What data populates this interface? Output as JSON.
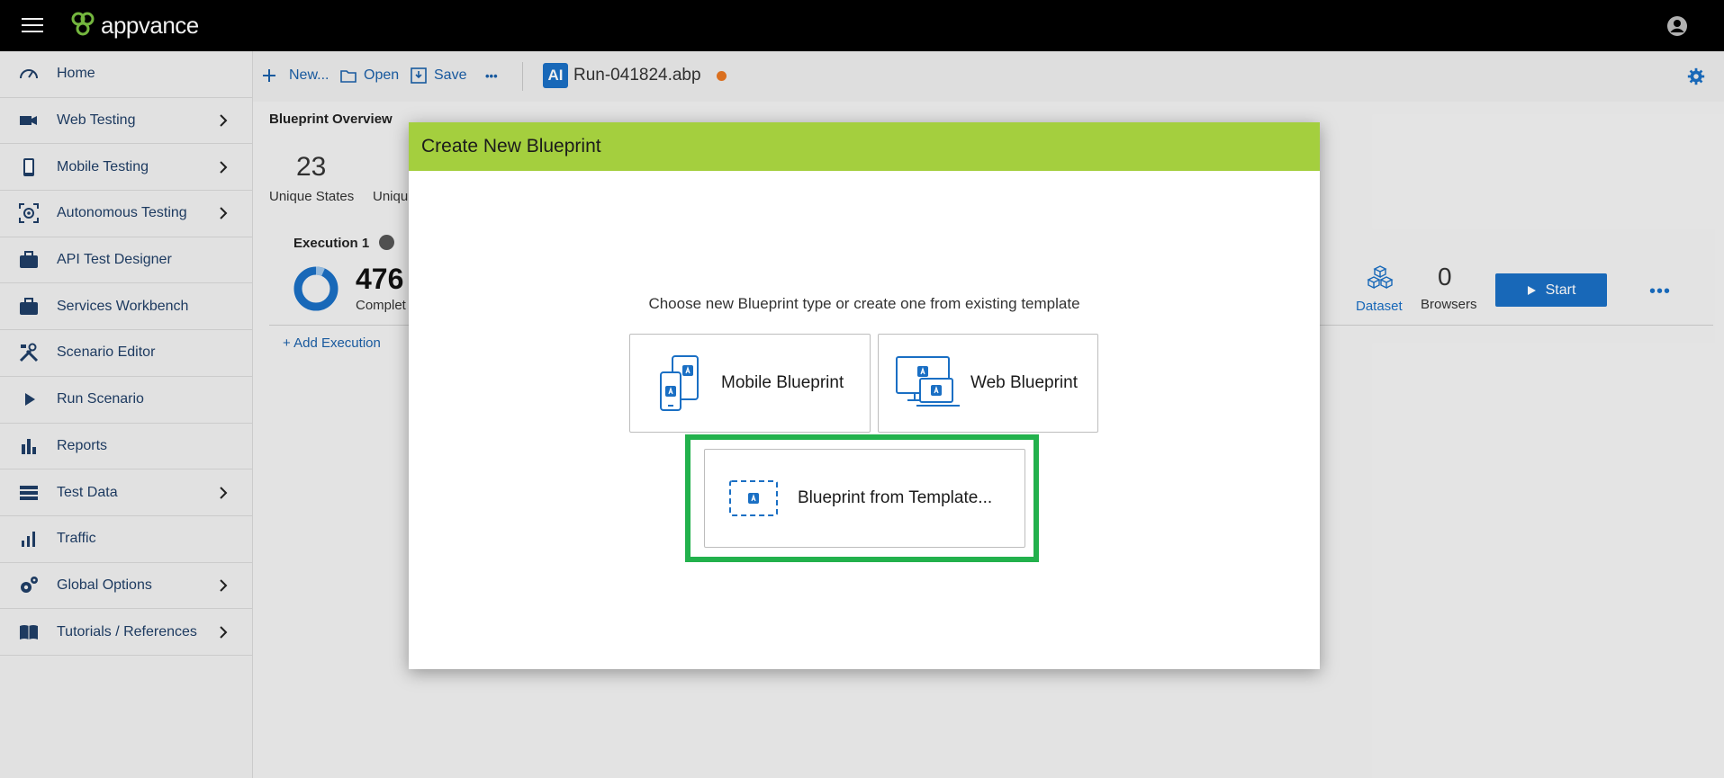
{
  "app": {
    "logo_text": "appvance",
    "hamburger_icon": "menu-icon",
    "account_icon": "account-circle-icon"
  },
  "sidebar": {
    "items": [
      {
        "label": "Home",
        "icon": "speedometer-icon",
        "has_children": false
      },
      {
        "label": "Web Testing",
        "icon": "video-camera-icon",
        "has_children": true
      },
      {
        "label": "Mobile Testing",
        "icon": "mobile-phone-icon",
        "has_children": true
      },
      {
        "label": "Autonomous Testing",
        "icon": "robot-scan-icon",
        "has_children": true
      },
      {
        "label": "API Test Designer",
        "icon": "briefcase-icon",
        "has_children": false
      },
      {
        "label": "Services Workbench",
        "icon": "briefcase-icon",
        "has_children": false
      },
      {
        "label": "Scenario Editor",
        "icon": "tools-icon",
        "has_children": false
      },
      {
        "label": "Run Scenario",
        "icon": "play-icon",
        "has_children": false
      },
      {
        "label": "Reports",
        "icon": "bar-chart-icon",
        "has_children": false
      },
      {
        "label": "Test Data",
        "icon": "list-icon",
        "has_children": true
      },
      {
        "label": "Traffic",
        "icon": "signal-bars-icon",
        "has_children": false
      },
      {
        "label": "Global Options",
        "icon": "gears-icon",
        "has_children": true
      },
      {
        "label": "Tutorials / References",
        "icon": "book-icon",
        "has_children": true
      }
    ]
  },
  "toolbar": {
    "new_label": "New...",
    "open_label": "Open",
    "save_label": "Save",
    "more_label": "•••",
    "ai_badge": "AI",
    "file_name": "Run-041824.abp",
    "unsaved_color": "#e87722"
  },
  "overview": {
    "title": "Blueprint Overview",
    "unique_states_value": "23",
    "unique_states_label": "Unique States",
    "second_stat_label": "Uniqu",
    "execution_title": "Execution 1",
    "execution_value": "476",
    "execution_sub": "Complet",
    "add_execution_label": "+ Add Execution",
    "dataset_label": "Dataset",
    "browsers_value": "0",
    "browsers_label": "Browsers",
    "start_label": "Start",
    "more_label": "•••"
  },
  "modal": {
    "title": "Create New Blueprint",
    "prompt": "Choose new Blueprint type or create one from existing template",
    "mobile_label": "Mobile Blueprint",
    "web_label": "Web Blueprint",
    "template_label": "Blueprint from Template..."
  },
  "colors": {
    "header_green": "#a4cf3e",
    "highlight_green": "#22b14c",
    "accent_blue": "#1a6fc4",
    "nav_text": "#1f3e66"
  }
}
